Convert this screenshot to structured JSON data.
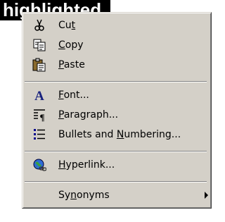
{
  "selection": {
    "text": "highlighted"
  },
  "menu": {
    "items": [
      {
        "pre": "Cu",
        "key": "t",
        "post": "",
        "icon": "scissors-icon"
      },
      {
        "pre": "",
        "key": "C",
        "post": "opy",
        "icon": "copy-icon"
      },
      {
        "pre": "",
        "key": "P",
        "post": "aste",
        "icon": "paste-icon"
      },
      {
        "pre": "",
        "key": "F",
        "post": "ont...",
        "icon": "font-icon"
      },
      {
        "pre": "",
        "key": "P",
        "post": "aragraph...",
        "icon": "paragraph-icon"
      },
      {
        "pre": "Bullets and ",
        "key": "N",
        "post": "umbering...",
        "icon": "bullets-icon"
      },
      {
        "pre": "",
        "key": "H",
        "post": "yperlink...",
        "icon": "hyperlink-icon"
      },
      {
        "pre": "Sy",
        "key": "n",
        "post": "onyms",
        "icon": "submenu-arrow-icon"
      }
    ]
  }
}
